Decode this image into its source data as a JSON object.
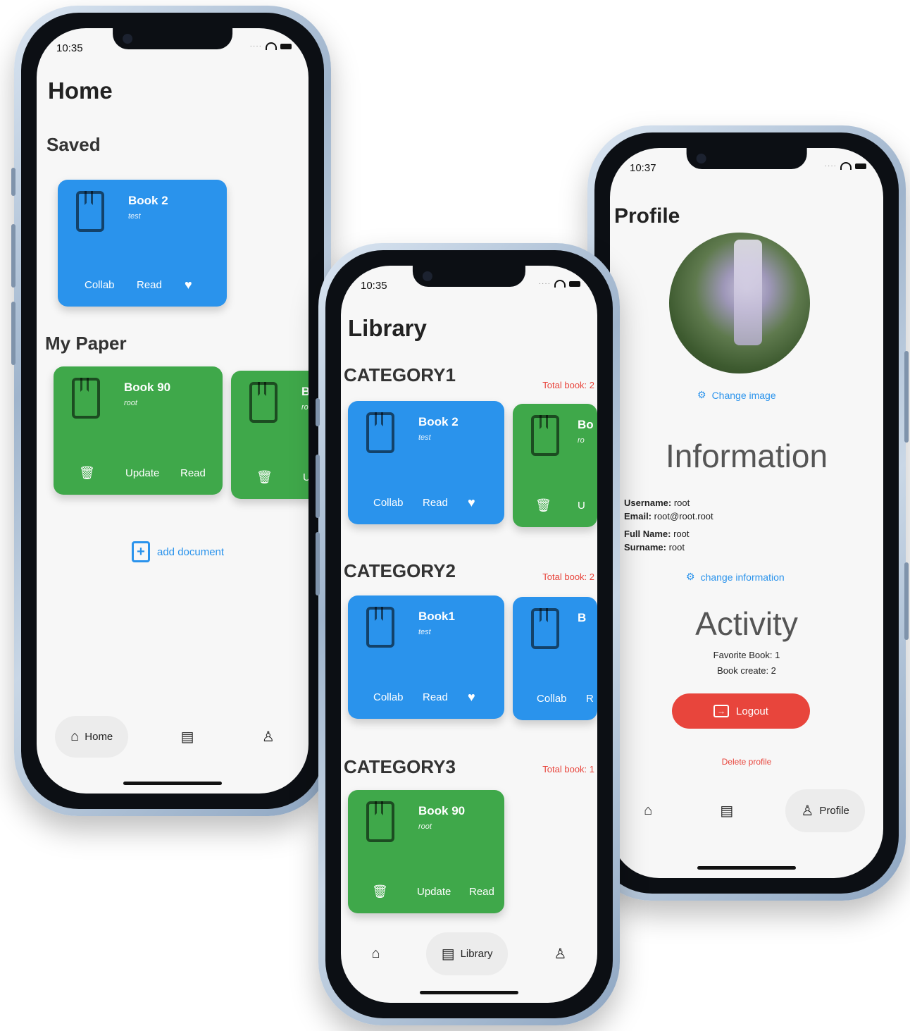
{
  "home": {
    "time": "10:35",
    "title": "Home",
    "saved_label": "Saved",
    "saved_card": {
      "title": "Book 2",
      "sub": "test",
      "collab": "Collab",
      "read": "Read"
    },
    "mypaper_label": "My Paper",
    "paper_card": {
      "title": "Book 90",
      "sub": "root",
      "update": "Update",
      "read": "Read"
    },
    "paper_card2_title": "B",
    "paper_card2_sub": "ro",
    "paper_card2_update": "U",
    "add_document": "add document",
    "nav": {
      "home": "Home"
    }
  },
  "library": {
    "time": "10:35",
    "title": "Library",
    "categories": [
      {
        "name": "CATEGORY1",
        "total": "Total book: 2"
      },
      {
        "name": "CATEGORY2",
        "total": "Total book: 2"
      },
      {
        "name": "CATEGORY3",
        "total": "Total book: 1"
      }
    ],
    "cat1_card": {
      "title": "Book 2",
      "sub": "test",
      "collab": "Collab",
      "read": "Read"
    },
    "cat1_card2": {
      "title": "Bo",
      "sub": "ro",
      "update": "U"
    },
    "cat2_card": {
      "title": "Book1",
      "sub": "test",
      "collab": "Collab",
      "read": "Read"
    },
    "cat2_card2": {
      "title": "B",
      "collab": "Collab",
      "read": "R"
    },
    "cat3_card": {
      "title": "Book 90",
      "sub": "root",
      "update": "Update",
      "read": "Read"
    },
    "nav": {
      "library": "Library"
    }
  },
  "profile": {
    "time": "10:37",
    "title": "Profile",
    "change_image": "Change image",
    "information_title": "Information",
    "username_label": "Username:",
    "username_value": " root",
    "email_label": "Email:",
    "email_value": " root@root.root",
    "fullname_label": "Full Name:",
    "fullname_value": " root",
    "surname_label": "Surname:",
    "surname_value": " root",
    "change_information": "change information",
    "activity_title": "Activity",
    "favorite_book": "Favorite Book: 1",
    "book_create": "Book create: 2",
    "logout": "Logout",
    "delete_profile": "Delete profile",
    "nav": {
      "profile": "Profile"
    }
  },
  "colors": {
    "blue": "#2a93ec",
    "green": "#3fa84a",
    "red": "#e8453c",
    "link": "#2a93ec"
  }
}
